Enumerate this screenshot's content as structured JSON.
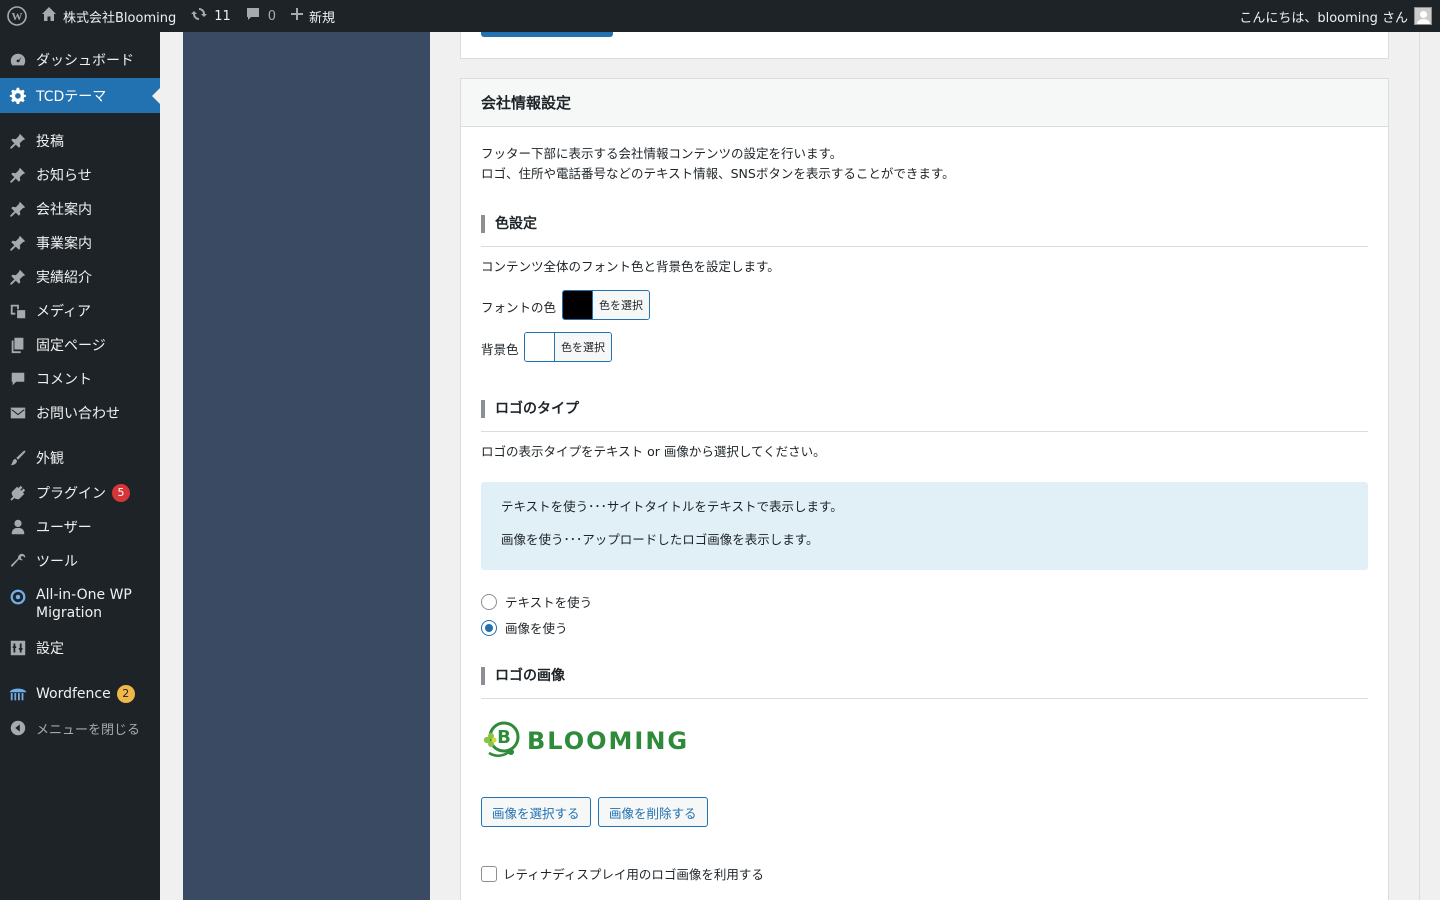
{
  "adminbar": {
    "site_name": "株式会社Blooming",
    "updates_count": "11",
    "comments_count": "0",
    "new_label": "新規",
    "greeting": "こんにちは、blooming さん"
  },
  "sidebar": {
    "items": [
      {
        "label": "ダッシュボード"
      },
      {
        "label": "TCDテーマ"
      },
      {
        "label": "投稿"
      },
      {
        "label": "お知らせ"
      },
      {
        "label": "会社案内"
      },
      {
        "label": "事業案内"
      },
      {
        "label": "実績紹介"
      },
      {
        "label": "メディア"
      },
      {
        "label": "固定ページ"
      },
      {
        "label": "コメント"
      },
      {
        "label": "お問い合わせ"
      },
      {
        "label": "外観"
      },
      {
        "label": "プラグイン",
        "badge": "5"
      },
      {
        "label": "ユーザー"
      },
      {
        "label": "ツール"
      },
      {
        "label": "All-in-One WP",
        "label2": "Migration"
      },
      {
        "label": "設定"
      },
      {
        "label": "Wordfence",
        "badge": "2"
      },
      {
        "label": "メニューを閉じる"
      }
    ],
    "badge_colors": {
      "plugins": "#d63638",
      "wordfence": "#f0b849"
    }
  },
  "company_box": {
    "title": "会社情報設定",
    "intro_line1": "フッター下部に表示する会社情報コンテンツの設定を行います。",
    "intro_line2": "ロゴ、住所や電話番号などのテキスト情報、SNSボタンを表示することができます。",
    "color_section": {
      "title": "色設定",
      "desc": "コンテンツ全体のフォント色と背景色を設定します。",
      "font_color_label": "フォントの色",
      "font_color_value": "#000000",
      "bg_color_label": "背景色",
      "bg_color_value": "#ffffff",
      "select_color_button": "色を選択"
    },
    "logo_type_section": {
      "title": "ロゴのタイプ",
      "desc": "ロゴの表示タイプをテキスト or 画像から選択してください。",
      "info_line1": "テキストを使う･･･サイトタイトルをテキストで表示します。",
      "info_line2": "画像を使う･･･アップロードしたロゴ画像を表示します。",
      "options": [
        {
          "label": "テキストを使う",
          "checked": false
        },
        {
          "label": "画像を使う",
          "checked": true
        }
      ]
    },
    "logo_image_section": {
      "title": "ロゴの画像",
      "logo_text": "BLOOMING",
      "select_image_button": "画像を選択する",
      "delete_image_button": "画像を削除する",
      "retina_label": "レティナディスプレイ用のロゴ画像を利用する",
      "retina_checked": false
    }
  }
}
